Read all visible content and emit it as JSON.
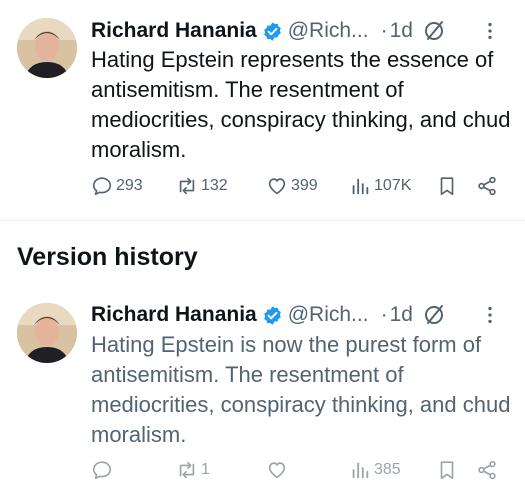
{
  "current_tweet": {
    "author_name": "Richard Hanania",
    "handle": "@Rich...",
    "separator": "·",
    "time": "1d",
    "text": "Hating Epstein represents the essence of antisemitism. The resentment of mediocrities, conspiracy thinking, and chud moralism.",
    "replies": "293",
    "retweets": "132",
    "likes": "399",
    "views": "107K"
  },
  "version_history": {
    "title": "Version history",
    "tweet": {
      "author_name": "Richard Hanania",
      "handle": "@Rich...",
      "separator": "·",
      "time": "1d",
      "text": "Hating Epstein is now the purest form of antisemitism. The resentment of mediocrities, conspiracy thinking, and chud moralism.",
      "replies": "",
      "retweets": "1",
      "likes": "",
      "views": "385"
    }
  },
  "colors": {
    "verified": "#1d9bf0",
    "text_primary": "#0f1419",
    "text_secondary": "#536471",
    "text_faded": "#9aa4ab"
  },
  "icons": [
    "verified-badge-icon",
    "edit-history-icon",
    "more-icon",
    "reply-icon",
    "retweet-icon",
    "like-icon",
    "views-icon",
    "bookmark-icon",
    "share-icon"
  ]
}
